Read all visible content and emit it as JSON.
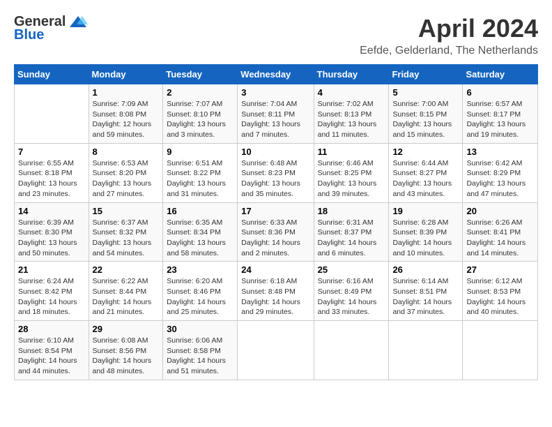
{
  "logo": {
    "general": "General",
    "blue": "Blue"
  },
  "title": "April 2024",
  "subtitle": "Eefde, Gelderland, The Netherlands",
  "days_of_week": [
    "Sunday",
    "Monday",
    "Tuesday",
    "Wednesday",
    "Thursday",
    "Friday",
    "Saturday"
  ],
  "weeks": [
    [
      {
        "day": "",
        "sunrise": "",
        "sunset": "",
        "daylight": ""
      },
      {
        "day": "1",
        "sunrise": "Sunrise: 7:09 AM",
        "sunset": "Sunset: 8:08 PM",
        "daylight": "Daylight: 12 hours and 59 minutes."
      },
      {
        "day": "2",
        "sunrise": "Sunrise: 7:07 AM",
        "sunset": "Sunset: 8:10 PM",
        "daylight": "Daylight: 13 hours and 3 minutes."
      },
      {
        "day": "3",
        "sunrise": "Sunrise: 7:04 AM",
        "sunset": "Sunset: 8:11 PM",
        "daylight": "Daylight: 13 hours and 7 minutes."
      },
      {
        "day": "4",
        "sunrise": "Sunrise: 7:02 AM",
        "sunset": "Sunset: 8:13 PM",
        "daylight": "Daylight: 13 hours and 11 minutes."
      },
      {
        "day": "5",
        "sunrise": "Sunrise: 7:00 AM",
        "sunset": "Sunset: 8:15 PM",
        "daylight": "Daylight: 13 hours and 15 minutes."
      },
      {
        "day": "6",
        "sunrise": "Sunrise: 6:57 AM",
        "sunset": "Sunset: 8:17 PM",
        "daylight": "Daylight: 13 hours and 19 minutes."
      }
    ],
    [
      {
        "day": "7",
        "sunrise": "Sunrise: 6:55 AM",
        "sunset": "Sunset: 8:18 PM",
        "daylight": "Daylight: 13 hours and 23 minutes."
      },
      {
        "day": "8",
        "sunrise": "Sunrise: 6:53 AM",
        "sunset": "Sunset: 8:20 PM",
        "daylight": "Daylight: 13 hours and 27 minutes."
      },
      {
        "day": "9",
        "sunrise": "Sunrise: 6:51 AM",
        "sunset": "Sunset: 8:22 PM",
        "daylight": "Daylight: 13 hours and 31 minutes."
      },
      {
        "day": "10",
        "sunrise": "Sunrise: 6:48 AM",
        "sunset": "Sunset: 8:23 PM",
        "daylight": "Daylight: 13 hours and 35 minutes."
      },
      {
        "day": "11",
        "sunrise": "Sunrise: 6:46 AM",
        "sunset": "Sunset: 8:25 PM",
        "daylight": "Daylight: 13 hours and 39 minutes."
      },
      {
        "day": "12",
        "sunrise": "Sunrise: 6:44 AM",
        "sunset": "Sunset: 8:27 PM",
        "daylight": "Daylight: 13 hours and 43 minutes."
      },
      {
        "day": "13",
        "sunrise": "Sunrise: 6:42 AM",
        "sunset": "Sunset: 8:29 PM",
        "daylight": "Daylight: 13 hours and 47 minutes."
      }
    ],
    [
      {
        "day": "14",
        "sunrise": "Sunrise: 6:39 AM",
        "sunset": "Sunset: 8:30 PM",
        "daylight": "Daylight: 13 hours and 50 minutes."
      },
      {
        "day": "15",
        "sunrise": "Sunrise: 6:37 AM",
        "sunset": "Sunset: 8:32 PM",
        "daylight": "Daylight: 13 hours and 54 minutes."
      },
      {
        "day": "16",
        "sunrise": "Sunrise: 6:35 AM",
        "sunset": "Sunset: 8:34 PM",
        "daylight": "Daylight: 13 hours and 58 minutes."
      },
      {
        "day": "17",
        "sunrise": "Sunrise: 6:33 AM",
        "sunset": "Sunset: 8:36 PM",
        "daylight": "Daylight: 14 hours and 2 minutes."
      },
      {
        "day": "18",
        "sunrise": "Sunrise: 6:31 AM",
        "sunset": "Sunset: 8:37 PM",
        "daylight": "Daylight: 14 hours and 6 minutes."
      },
      {
        "day": "19",
        "sunrise": "Sunrise: 6:28 AM",
        "sunset": "Sunset: 8:39 PM",
        "daylight": "Daylight: 14 hours and 10 minutes."
      },
      {
        "day": "20",
        "sunrise": "Sunrise: 6:26 AM",
        "sunset": "Sunset: 8:41 PM",
        "daylight": "Daylight: 14 hours and 14 minutes."
      }
    ],
    [
      {
        "day": "21",
        "sunrise": "Sunrise: 6:24 AM",
        "sunset": "Sunset: 8:42 PM",
        "daylight": "Daylight: 14 hours and 18 minutes."
      },
      {
        "day": "22",
        "sunrise": "Sunrise: 6:22 AM",
        "sunset": "Sunset: 8:44 PM",
        "daylight": "Daylight: 14 hours and 21 minutes."
      },
      {
        "day": "23",
        "sunrise": "Sunrise: 6:20 AM",
        "sunset": "Sunset: 8:46 PM",
        "daylight": "Daylight: 14 hours and 25 minutes."
      },
      {
        "day": "24",
        "sunrise": "Sunrise: 6:18 AM",
        "sunset": "Sunset: 8:48 PM",
        "daylight": "Daylight: 14 hours and 29 minutes."
      },
      {
        "day": "25",
        "sunrise": "Sunrise: 6:16 AM",
        "sunset": "Sunset: 8:49 PM",
        "daylight": "Daylight: 14 hours and 33 minutes."
      },
      {
        "day": "26",
        "sunrise": "Sunrise: 6:14 AM",
        "sunset": "Sunset: 8:51 PM",
        "daylight": "Daylight: 14 hours and 37 minutes."
      },
      {
        "day": "27",
        "sunrise": "Sunrise: 6:12 AM",
        "sunset": "Sunset: 8:53 PM",
        "daylight": "Daylight: 14 hours and 40 minutes."
      }
    ],
    [
      {
        "day": "28",
        "sunrise": "Sunrise: 6:10 AM",
        "sunset": "Sunset: 8:54 PM",
        "daylight": "Daylight: 14 hours and 44 minutes."
      },
      {
        "day": "29",
        "sunrise": "Sunrise: 6:08 AM",
        "sunset": "Sunset: 8:56 PM",
        "daylight": "Daylight: 14 hours and 48 minutes."
      },
      {
        "day": "30",
        "sunrise": "Sunrise: 6:06 AM",
        "sunset": "Sunset: 8:58 PM",
        "daylight": "Daylight: 14 hours and 51 minutes."
      },
      {
        "day": "",
        "sunrise": "",
        "sunset": "",
        "daylight": ""
      },
      {
        "day": "",
        "sunrise": "",
        "sunset": "",
        "daylight": ""
      },
      {
        "day": "",
        "sunrise": "",
        "sunset": "",
        "daylight": ""
      },
      {
        "day": "",
        "sunrise": "",
        "sunset": "",
        "daylight": ""
      }
    ]
  ]
}
